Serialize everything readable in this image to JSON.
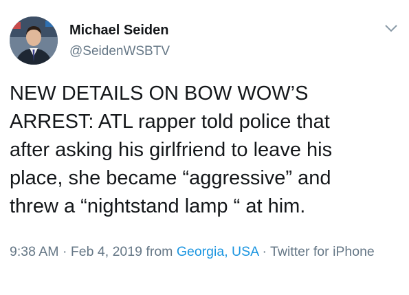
{
  "author": {
    "display_name": "Michael Seiden",
    "handle": "@SeidenWSBTV",
    "avatar_icon": "profile-photo"
  },
  "menu_icon": "chevron-down-icon",
  "tweet": {
    "text": "NEW DETAILS ON BOW WOW’S\nARREST: ATL rapper told police that\nafter asking  his girlfriend to leave his\nplace, she became “aggressive” and\nthrew a “nightstand lamp “ at him."
  },
  "meta": {
    "time": "9:38 AM",
    "separator": " · ",
    "date": "Feb 4, 2019",
    "from_label": " from ",
    "location": "Georgia, USA",
    "separator2": " · ",
    "client": "Twitter for iPhone"
  },
  "colors": {
    "text": "#14171a",
    "secondary": "#657786",
    "link": "#1b95e0"
  }
}
